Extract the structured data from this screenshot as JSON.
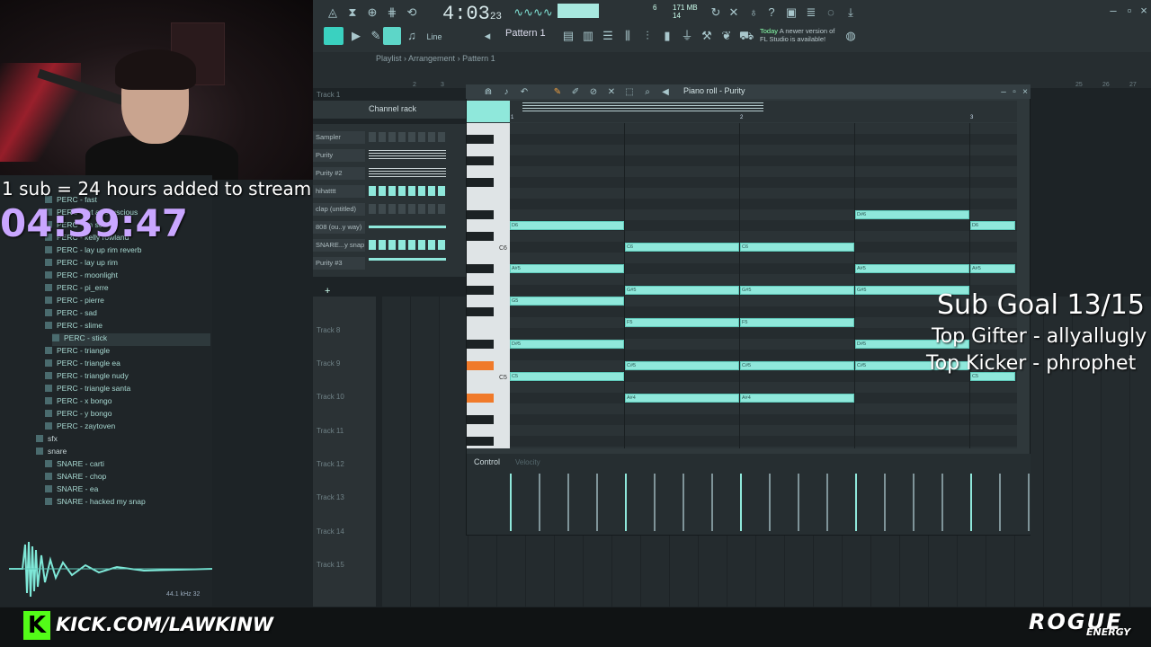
{
  "window": {
    "app": "FL Studio"
  },
  "toolbar": {
    "song_time": "4:03",
    "song_time_small": "23",
    "cpu_top": "171 MB",
    "cpu_bottom": "14",
    "cpu_side": "6",
    "pattern": "Pattern 1",
    "snap": "Line",
    "news_title": "Today",
    "news_text": "A newer version of FL Studio is available!"
  },
  "playlist": {
    "breadcrumb": [
      "Playlist",
      "Arrangement",
      "Pattern 1"
    ],
    "track1": "Track 1",
    "tracks": [
      "Track 8",
      "Track 9",
      "Track 10",
      "Track 11",
      "Track 12",
      "Track 13",
      "Track 14",
      "Track 15"
    ],
    "bar_numbers": [
      "2",
      "3",
      "25",
      "26",
      "27"
    ]
  },
  "channel_rack": {
    "title": "Channel rack",
    "channels": [
      "Sampler",
      "Purity",
      "Purity #2",
      "hihatttt",
      "clap (untitled)",
      "808 (ou..y way)",
      "SNARE...y snap",
      "Purity #3"
    ],
    "add_label": "+"
  },
  "browser": {
    "items": [
      {
        "label": "PERC - fast",
        "type": "file"
      },
      {
        "label": "PERC - fat and luscious",
        "type": "file"
      },
      {
        "label": "PERC - im scared",
        "type": "file"
      },
      {
        "label": "PERC - kelly rowland",
        "type": "file"
      },
      {
        "label": "PERC - lay up rim reverb",
        "type": "file"
      },
      {
        "label": "PERC - lay up rim",
        "type": "file"
      },
      {
        "label": "PERC - moonlight",
        "type": "file"
      },
      {
        "label": "PERC - pi_erre",
        "type": "file"
      },
      {
        "label": "PERC - pierre",
        "type": "file"
      },
      {
        "label": "PERC - sad",
        "type": "file"
      },
      {
        "label": "PERC - slime",
        "type": "file"
      },
      {
        "label": "PERC - stick",
        "type": "file",
        "selected": true
      },
      {
        "label": "PERC - triangle",
        "type": "file"
      },
      {
        "label": "PERC - triangle ea",
        "type": "file"
      },
      {
        "label": "PERC - triangle nudy",
        "type": "file"
      },
      {
        "label": "PERC - triangle santa",
        "type": "file"
      },
      {
        "label": "PERC - x bongo",
        "type": "file"
      },
      {
        "label": "PERC - y bongo",
        "type": "file"
      },
      {
        "label": "PERC - zaytoven",
        "type": "file"
      },
      {
        "label": "sfx",
        "type": "folder"
      },
      {
        "label": "snare",
        "type": "folder"
      },
      {
        "label": "SNARE - carti",
        "type": "file"
      },
      {
        "label": "SNARE - chop",
        "type": "file"
      },
      {
        "label": "SNARE - ea",
        "type": "file"
      },
      {
        "label": "SNARE - hacked my snap",
        "type": "file"
      }
    ],
    "sample_info": "44.1 kHz 32"
  },
  "piano_roll": {
    "title": "Piano roll - Purity",
    "key_labels": {
      "c6": "C6",
      "c5": "C5"
    },
    "bar_labels": [
      "1",
      "2",
      "3"
    ],
    "notes": [
      {
        "label": "D#6",
        "row": 8,
        "start": 3.0,
        "len": 1.0
      },
      {
        "label": "D6",
        "row": 9,
        "start": 0.0,
        "len": 1.0
      },
      {
        "label": "D6",
        "row": 9,
        "start": 4.0,
        "len": 0.4
      },
      {
        "label": "C6",
        "row": 11,
        "start": 1.0,
        "len": 1.0
      },
      {
        "label": "C6",
        "row": 11,
        "start": 2.0,
        "len": 1.0
      },
      {
        "label": "A#5",
        "row": 13,
        "start": 0.0,
        "len": 1.0
      },
      {
        "label": "A#5",
        "row": 13,
        "start": 3.0,
        "len": 1.0
      },
      {
        "label": "A#5",
        "row": 13,
        "start": 4.0,
        "len": 0.4
      },
      {
        "label": "G#5",
        "row": 15,
        "start": 1.0,
        "len": 1.0
      },
      {
        "label": "G#5",
        "row": 15,
        "start": 2.0,
        "len": 1.0
      },
      {
        "label": "G#5",
        "row": 15,
        "start": 3.0,
        "len": 1.0
      },
      {
        "label": "G5",
        "row": 16,
        "start": 0.0,
        "len": 1.0
      },
      {
        "label": "F5",
        "row": 18,
        "start": 1.0,
        "len": 1.0
      },
      {
        "label": "F5",
        "row": 18,
        "start": 2.0,
        "len": 1.0
      },
      {
        "label": "D#5",
        "row": 20,
        "start": 0.0,
        "len": 1.0
      },
      {
        "label": "D#5",
        "row": 20,
        "start": 3.0,
        "len": 1.0
      },
      {
        "label": "C#5",
        "row": 22,
        "start": 1.0,
        "len": 1.0
      },
      {
        "label": "C#5",
        "row": 22,
        "start": 2.0,
        "len": 1.0
      },
      {
        "label": "C#5",
        "row": 22,
        "start": 3.0,
        "len": 1.0
      },
      {
        "label": "C5",
        "row": 23,
        "start": 0.0,
        "len": 1.0
      },
      {
        "label": "C5",
        "row": 23,
        "start": 4.0,
        "len": 0.4
      },
      {
        "label": "A#4",
        "row": 25,
        "start": 1.0,
        "len": 1.0
      },
      {
        "label": "A#4",
        "row": 25,
        "start": 2.0,
        "len": 1.0
      }
    ],
    "control_label": "Control",
    "control_param": "Velocity"
  },
  "stream": {
    "sub_line": "1 sub = 24 hours added to stream",
    "timer": "04:39:47",
    "sub_goal": "Sub Goal 13/15",
    "top_gifter": "Top Gifter - allyallugly",
    "top_kicker": "Top Kicker - phrophet",
    "channel_url": "KICK.COM/LAWKINW",
    "sponsor": "ROGUE",
    "sponsor_sub": "ENERGY"
  },
  "colors": {
    "accent": "#8fe8db",
    "accent_border": "#5fc9ba",
    "timer": "#c9a6ff",
    "key_highlight": "#f07a2a",
    "kick_green": "#53fc18"
  }
}
